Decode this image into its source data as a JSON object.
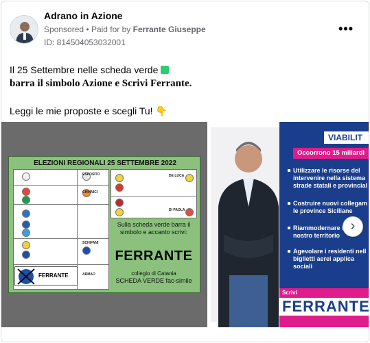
{
  "post": {
    "page_name": "Adrano in Azione",
    "sponsored": "Sponsored",
    "separator": "•",
    "paid_for_by": "Paid for by",
    "payer": "Ferrante Giuseppe",
    "ad_id": "ID: 814504053032001"
  },
  "body": {
    "line1": "Il 25 Settembre nelle scheda verde",
    "line2": "barra il simbolo Azione e Scrivi Ferrante",
    "line2_end": ".",
    "line3": "Leggi le mie proposte e scegli Tu!",
    "line3_emoji": "👇"
  },
  "slide1": {
    "title": "ELEZIONI REGIONALI 25 SETTEMBRE 2022",
    "cand_esposito": "ESPOSITO",
    "cand_chinnici": "CHINNICI",
    "cand_schifani": "SCHIFANI",
    "cand_armao": "ARMAO",
    "cand_deluca": "DE LUCA",
    "cand_dipaola": "DI PAOLA",
    "azione_name": "FERRANTE",
    "note": "Sulla scheda verde barra il simbolo e accanto scrivi:",
    "name": "FERRANTE",
    "collegio": "collegio di Catania",
    "scheda": "SCHEDA VERDE fac-simile"
  },
  "slide2": {
    "heading": "VIABILIT",
    "occorrono": "Occorrono 15 miliardi",
    "b1": "Utilizzare le risorse del intervenire nella sistema strade statali e provincial",
    "b2": "Costruire nuovi collegam le province Siciliane",
    "b3": "Riammodernare l del nostro territorio",
    "b4": "Agevolare i residenti nell biglietti aerei applica sociali",
    "scrivi": "Scrivi",
    "name": "FERRANTE"
  },
  "controls": {
    "more": "•••",
    "next": "›"
  },
  "colors": {
    "blue": "#1b3e8c",
    "pink": "#e01c8c",
    "ballot_green": "#8bc17d"
  }
}
